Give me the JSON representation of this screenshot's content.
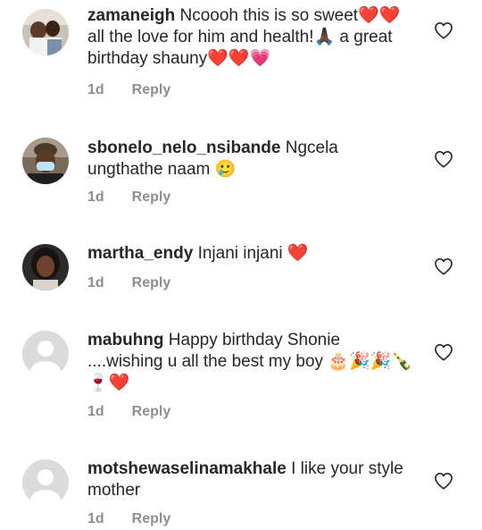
{
  "comments": [
    {
      "username": "zamaneigh",
      "text": "Ncoooh this is so sweet❤️❤️ all the love for him and health!🙏🏿 a great birthday shauny❤️❤️💗",
      "time": "1d",
      "reply": "Reply",
      "avatar": "photo-avatar-group"
    },
    {
      "username": "sbonelo_nelo_nsibande",
      "text": "Ngcela ungthathe naam 🥲",
      "time": "1d",
      "reply": "Reply",
      "avatar": "photo-avatar-masked-man"
    },
    {
      "username": "martha_endy",
      "text": "Injani injani ❤️",
      "time": "1d",
      "reply": "Reply",
      "avatar": "photo-avatar-woman"
    },
    {
      "username": "mabuhng",
      "text": "Happy birthday Shonie ....wishing u all the best my boy 🎂🎉🎉🍾🍷❤️",
      "time": "1d",
      "reply": "Reply",
      "avatar": "default-avatar"
    },
    {
      "username": "motshewaselinamakhale",
      "text": "I like your style mother",
      "time": "1d",
      "reply": "Reply",
      "avatar": "default-avatar"
    }
  ],
  "colors": {
    "text": "#262626",
    "meta": "#8e8e8e",
    "heart_outline": "#262626",
    "heart_red": "#ed1c24"
  }
}
